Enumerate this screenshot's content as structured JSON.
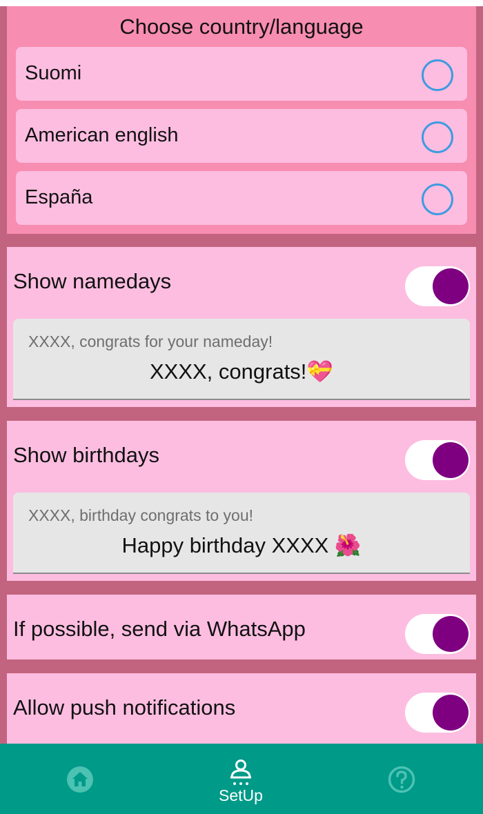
{
  "language": {
    "title": "Choose country/language",
    "options": [
      {
        "label": "Suomi",
        "selected": false
      },
      {
        "label": "American english",
        "selected": false
      },
      {
        "label": "España",
        "selected": false
      }
    ]
  },
  "namedays": {
    "label": "Show namedays",
    "enabled": true,
    "placeholder": "XXXX, congrats for your nameday!",
    "value": "XXXX, congrats!💝"
  },
  "birthdays": {
    "label": "Show birthdays",
    "enabled": true,
    "placeholder": "XXXX, birthday congrats to you!",
    "value": "Happy birthday XXXX 🌺"
  },
  "whatsapp": {
    "label": "If possible, send via WhatsApp",
    "enabled": true
  },
  "push": {
    "label": "Allow push notifications",
    "enabled": true
  },
  "nav": {
    "items": [
      {
        "icon": "home-icon",
        "label": ""
      },
      {
        "icon": "setup-icon",
        "label": "SetUp",
        "active": true
      },
      {
        "icon": "help-icon",
        "label": ""
      }
    ]
  },
  "colors": {
    "background": "#c2647f",
    "section": "#f78db0",
    "card": "#fdbde0",
    "toggle_on": "#7e0081",
    "radio": "#3d9be0",
    "nav": "#009a88"
  }
}
